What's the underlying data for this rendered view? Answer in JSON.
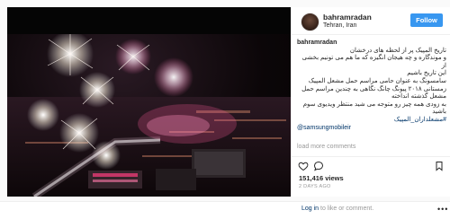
{
  "post": {
    "username": "bahramradan",
    "location": "Tehran, Iran",
    "follow_label": "Follow",
    "caption_user": "bahramradan",
    "caption_lines": [
      "تاریخ المپیک پر از لحظه های درخشان",
      "و موندگاره و چه هیجان انگیزه که ما هم می تونیم بخشی از",
      "این تاریخ باشیم",
      "سامسونگ به عنوان حامی مراسم حمل مشعل المپیک",
      "زمستانی ۲۰۱۸ پیونگ چانگ نگاهی به چندین مراسم حمل",
      "مشعل گذشته انداخته",
      "به زودی همه چیز رو متوجه می شید منتظر ویدیوی سوم",
      "باشید"
    ],
    "hashtag": "#مشعلداران_المپیک",
    "mention": "@samsungmobileir",
    "load_more": "load more comments",
    "views": "151,416 views",
    "time_ago": "2 DAYS AGO",
    "login_prefix": "Log in",
    "login_suffix": " to like or comment.",
    "more_label": "•••"
  },
  "icons": {
    "like": "heart-icon",
    "comment": "comment-icon",
    "bookmark": "bookmark-icon"
  },
  "colors": {
    "follow_button": "#3897f0",
    "link": "#003569"
  }
}
